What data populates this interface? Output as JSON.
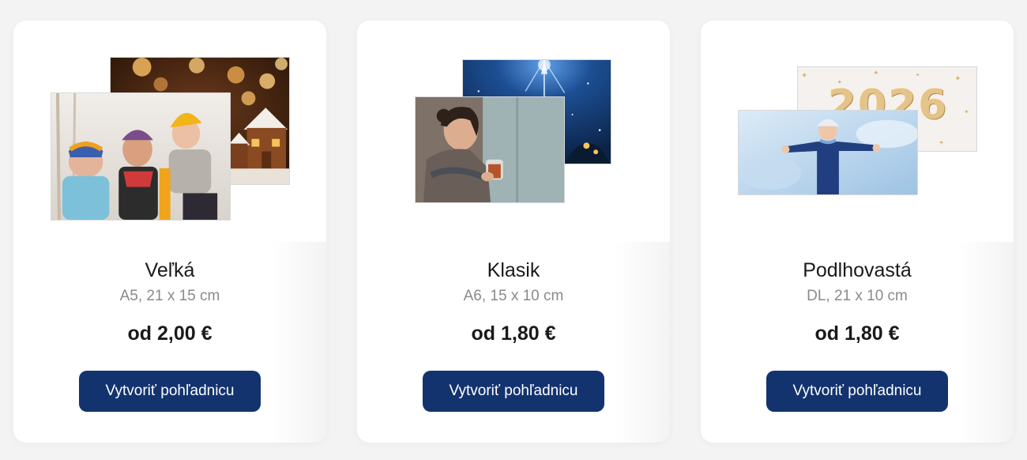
{
  "cards": [
    {
      "title": "Veľká",
      "size": "A5, 21 x 15 cm",
      "price": "od 2,00 €",
      "button_label": "Vytvoriť pohľadnicu"
    },
    {
      "title": "Klasik",
      "size": "A6, 15 x 10 cm",
      "price": "od 1,80 €",
      "button_label": "Vytvoriť pohľadnicu"
    },
    {
      "title": "Podlhovastá",
      "size": "DL, 21 x 10 cm",
      "price": "od 1,80 €",
      "button_label": "Vytvoriť pohľadnicu"
    }
  ],
  "colors": {
    "button": "#13336e",
    "background": "#f3f3f4",
    "card": "#ffffff"
  },
  "balloon_text": "2026"
}
